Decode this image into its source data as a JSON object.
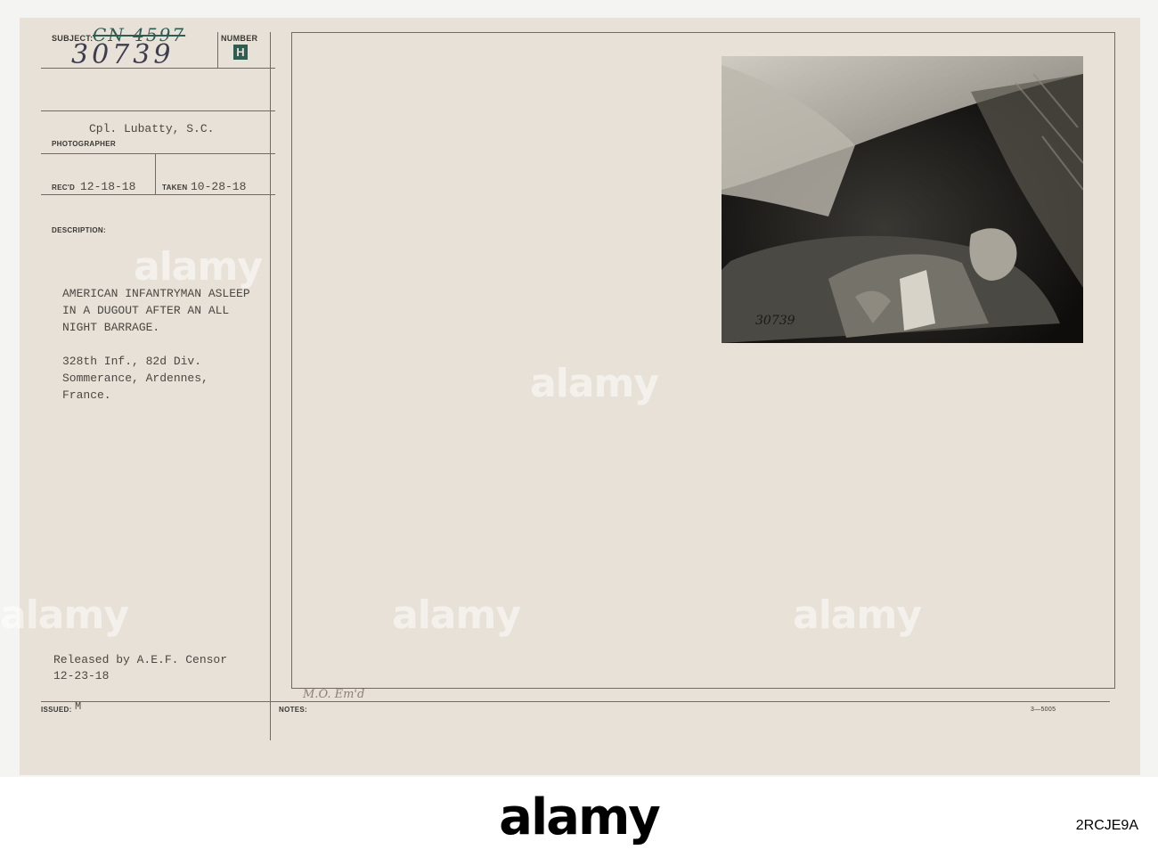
{
  "card": {
    "subject_label": "SUBJECT:",
    "subject_struck": "CN 4597",
    "subject_number": "30739",
    "number_label": "NUMBER",
    "number_value": "H",
    "photographer_name": "Cpl. Lubatty, S.C.",
    "photographer_label": "PHOTOGRAPHER",
    "recd_label": "REC'D",
    "recd_date": "12-18-18",
    "taken_label": "TAKEN",
    "taken_date": "10-28-18",
    "description_label": "DESCRIPTION:",
    "description_lines": [
      "AMERICAN INFANTRYMAN ASLEEP",
      "IN A DUGOUT AFTER AN ALL",
      "NIGHT BARRAGE."
    ],
    "unit_lines": [
      "328th Inf., 82d Div.",
      "Sommerance, Ardennes,",
      "France."
    ],
    "release_lines": [
      "Released by A.E.F. Censor",
      "12-23-18"
    ],
    "issued_label": "ISSUED:",
    "issued_value": "M",
    "notes_label": "NOTES:",
    "notes_handwritten": "M.O. Em'd",
    "form_number": "3—5005",
    "photo_number": "30739"
  },
  "watermark_text": "alamy",
  "footer": {
    "logo": "alamy",
    "stock_id": "2RCJE9A"
  },
  "colors": {
    "card": "#e8e1d7",
    "ink": "#4a4742",
    "stamp": "#2f5d54"
  }
}
